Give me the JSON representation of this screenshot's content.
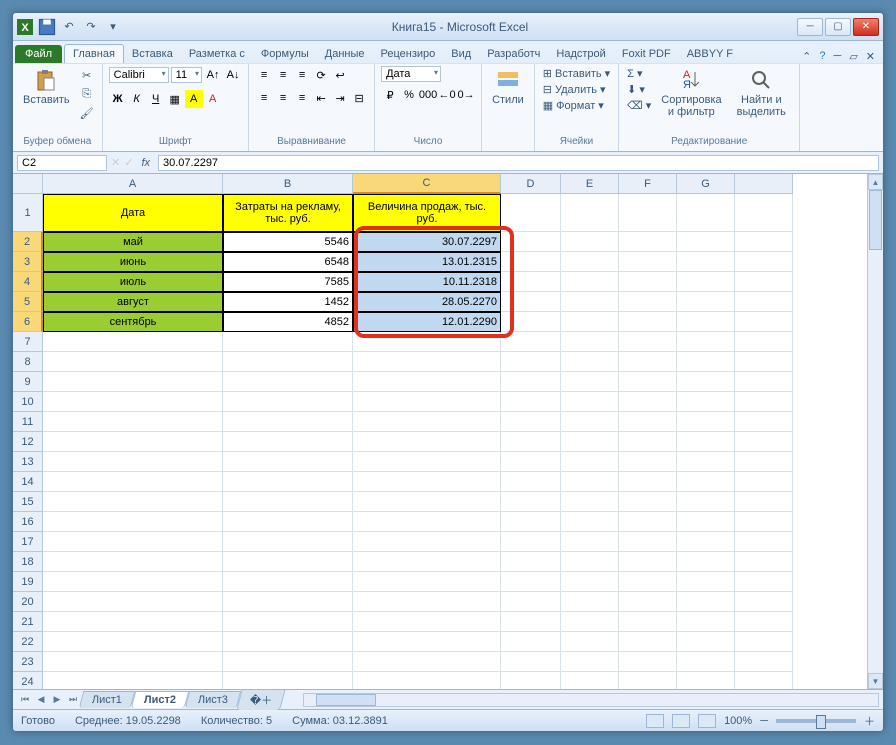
{
  "window": {
    "title": "Книга15  -  Microsoft Excel"
  },
  "qat": {
    "save": "save",
    "undo": "undo",
    "redo": "redo"
  },
  "tabs": {
    "file": "Файл",
    "home": "Главная",
    "insert": "Вставка",
    "layout": "Разметка с",
    "formulas": "Формулы",
    "data": "Данные",
    "review": "Рецензиро",
    "view": "Вид",
    "dev": "Разработч",
    "addins": "Надстрой",
    "foxit": "Foxit PDF",
    "abbyy": "ABBYY F"
  },
  "groups": {
    "clipboard": {
      "label": "Буфер обмена",
      "paste": "Вставить"
    },
    "font": {
      "label": "Шрифт",
      "name": "Calibri",
      "size": "11"
    },
    "alignment": {
      "label": "Выравнивание"
    },
    "number": {
      "label": "Число",
      "format": "Дата"
    },
    "styles": {
      "label": "Стили",
      "btn": "Стили"
    },
    "cells": {
      "label": "Ячейки",
      "insert": "Вставить",
      "delete": "Удалить",
      "format": "Формат"
    },
    "editing": {
      "label": "Редактирование",
      "sort": "Сортировка и фильтр",
      "find": "Найти и выделить"
    }
  },
  "formula": {
    "ref": "C2",
    "value": "30.07.2297"
  },
  "cols": [
    "A",
    "B",
    "C",
    "D",
    "E",
    "F",
    "G"
  ],
  "headers": {
    "A": "Дата",
    "B": "Затраты на рекламу, тыс. руб.",
    "C": "Величина продаж, тыс. руб."
  },
  "rows": [
    {
      "n": "2",
      "a": "май",
      "b": "5546",
      "c": "30.07.2297"
    },
    {
      "n": "3",
      "a": "июнь",
      "b": "6548",
      "c": "13.01.2315"
    },
    {
      "n": "4",
      "a": "июль",
      "b": "7585",
      "c": "10.11.2318"
    },
    {
      "n": "5",
      "a": "август",
      "b": "1452",
      "c": "28.05.2270"
    },
    {
      "n": "6",
      "a": "сентябрь",
      "b": "4852",
      "c": "12.01.2290"
    }
  ],
  "emptyrows": [
    "7",
    "8",
    "9",
    "10",
    "11",
    "12",
    "13",
    "14",
    "15",
    "16",
    "17",
    "18",
    "19",
    "20",
    "21",
    "22",
    "23",
    "24"
  ],
  "sheets": {
    "s1": "Лист1",
    "s2": "Лист2",
    "s3": "Лист3"
  },
  "status": {
    "ready": "Готово",
    "avg": "Среднее: 19.05.2298",
    "count": "Количество: 5",
    "sum": "Сумма: 03.12.3891",
    "zoom": "100%"
  }
}
